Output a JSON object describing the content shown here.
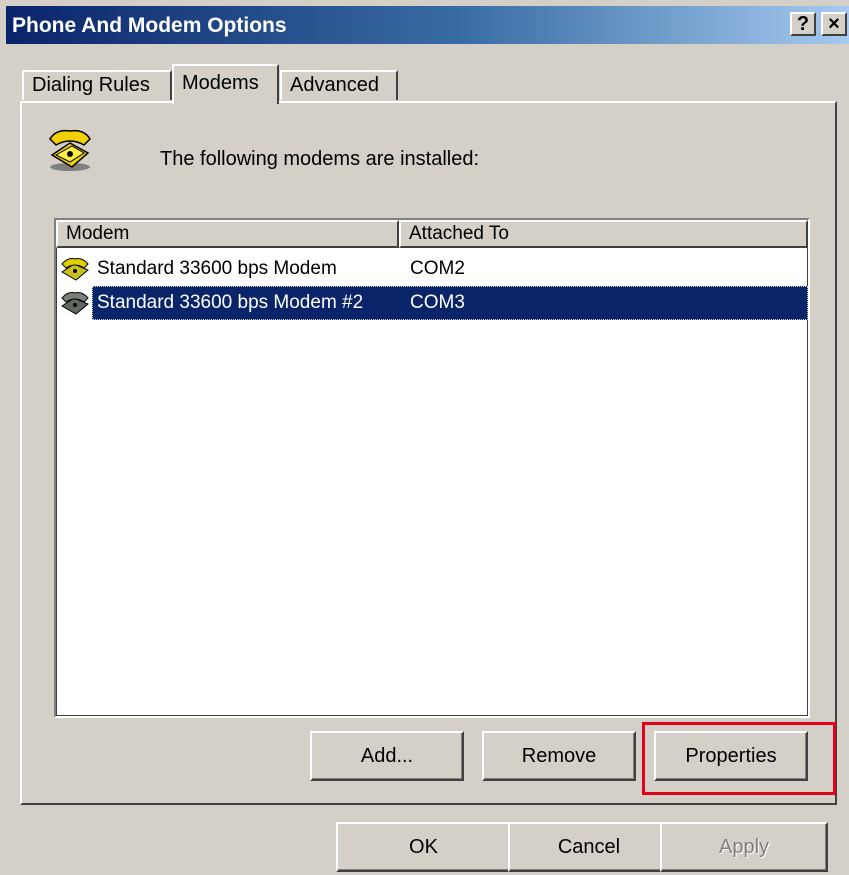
{
  "window": {
    "title": "Phone And Modem Options",
    "help_label": "?",
    "close_label": "×"
  },
  "tabs": [
    {
      "label": "Dialing Rules",
      "active": false
    },
    {
      "label": "Modems",
      "active": true
    },
    {
      "label": "Advanced",
      "active": false
    }
  ],
  "modems_tab": {
    "intro_text": "The following modems are installed:",
    "columns": [
      "Modem",
      "Attached To"
    ],
    "rows": [
      {
        "modem": "Standard 33600 bps Modem",
        "attached_to": "COM2",
        "selected": false
      },
      {
        "modem": "Standard 33600 bps Modem #2",
        "attached_to": "COM3",
        "selected": true
      }
    ],
    "buttons": {
      "add": "Add...",
      "remove": "Remove",
      "properties": "Properties"
    }
  },
  "dialog_buttons": {
    "ok": "OK",
    "cancel": "Cancel",
    "apply": "Apply",
    "apply_disabled": true
  },
  "colors": {
    "title_start": "#0a246a",
    "title_end": "#a6caf0",
    "selection": "#0a246a",
    "highlight_box": "#e3001b",
    "face": "#d4d0c8"
  },
  "icons": {
    "header": "telephone-icon",
    "row": "modem-icon"
  }
}
